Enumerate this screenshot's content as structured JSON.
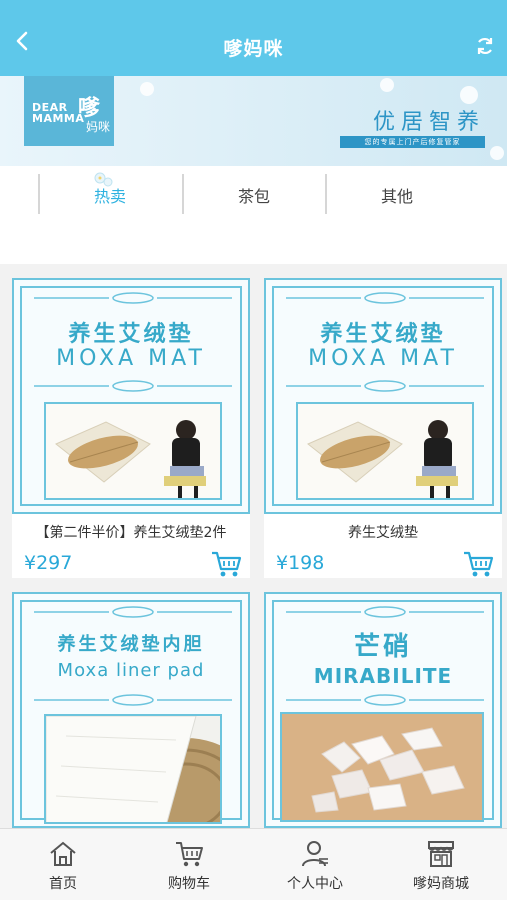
{
  "header": {
    "title": "嗲妈咪"
  },
  "banner": {
    "logo_en_line1": "DEAR",
    "logo_en_line2": "MAMMA",
    "logo_cn": "嗲",
    "logo_cn_small": "妈咪",
    "slogan": "优居智养",
    "subtitle": "您的专属上门产后修复管家"
  },
  "tabs": [
    {
      "label": "热卖",
      "active": true
    },
    {
      "label": "茶包",
      "active": false
    },
    {
      "label": "其他",
      "active": false
    }
  ],
  "products": [
    {
      "name": "【第二件半价】养生艾绒垫2件",
      "price": "¥297",
      "image_cn": "养生艾绒垫",
      "image_en": "MOXA MAT"
    },
    {
      "name": "养生艾绒垫",
      "price": "¥198",
      "image_cn": "养生艾绒垫",
      "image_en": "MOXA MAT"
    },
    {
      "name": "",
      "price": "",
      "image_cn": "养生艾绒垫内胆",
      "image_en": "Moxa liner pad"
    },
    {
      "name": "",
      "price": "",
      "image_cn": "芒硝",
      "image_en": "MIRABILITE"
    }
  ],
  "bottom_nav": [
    {
      "label": "首页",
      "icon": "home-icon"
    },
    {
      "label": "购物车",
      "icon": "cart-icon"
    },
    {
      "label": "个人中心",
      "icon": "user-icon"
    },
    {
      "label": "嗲妈商城",
      "icon": "shop-icon"
    }
  ],
  "colors": {
    "accent": "#5ec8ea",
    "price": "#29a8d8",
    "tab_active": "#2fb2e0"
  }
}
